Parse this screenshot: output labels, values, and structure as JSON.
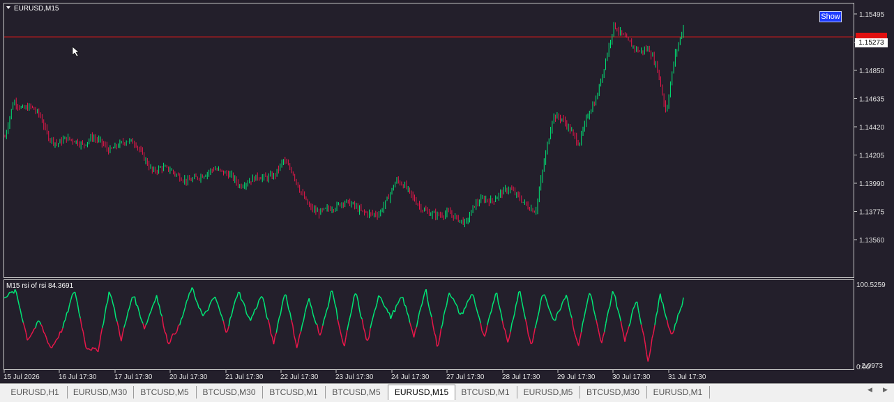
{
  "symbol_title": "EURUSD,M15",
  "show_button": "Show",
  "current_price": "1.15273",
  "indicator_label": "M15 rsi of rsi  84.3691",
  "colors": {
    "background": "#231f2b",
    "bull": "#00e676",
    "bear": "#e8174a",
    "price_line": "#d01818",
    "active_tab": "#ffffff"
  },
  "price_axis": [
    "1.15495",
    "1.15065",
    "1.14850",
    "1.14635",
    "1.14420",
    "1.14205",
    "1.13990",
    "1.13775",
    "1.13560"
  ],
  "indicator_axis": {
    "max": "100.5259",
    "min": "-2.0973",
    "overlap": "0.00"
  },
  "time_axis": [
    "15 Jul 2026",
    "16 Jul 17:30",
    "17 Jul 17:30",
    "20 Jul 17:30",
    "21 Jul 17:30",
    "22 Jul 17:30",
    "23 Jul 17:30",
    "24 Jul 17:30",
    "27 Jul 17:30",
    "28 Jul 17:30",
    "29 Jul 17:30",
    "30 Jul 17:30",
    "31 Jul 17:30"
  ],
  "tabs": [
    {
      "label": "EURUSD,H1",
      "active": false
    },
    {
      "label": "EURUSD,M30",
      "active": false
    },
    {
      "label": "BTCUSD,M5",
      "active": false
    },
    {
      "label": "BTCUSD,M30",
      "active": false
    },
    {
      "label": "BTCUSD,M1",
      "active": false
    },
    {
      "label": "BTCUSD,M5",
      "active": false
    },
    {
      "label": "EURUSD,M15",
      "active": true
    },
    {
      "label": "BTCUSD,M1",
      "active": false
    },
    {
      "label": "EURUSD,M5",
      "active": false
    },
    {
      "label": "BTCUSD,M30",
      "active": false
    },
    {
      "label": "EURUSD,M1",
      "active": false
    }
  ],
  "scroll_left_icon": "triangle-left",
  "scroll_right_icon": "triangle-right",
  "chart_data": {
    "type": "line",
    "series": [
      {
        "values": [
          1.1444,
          1.1475,
          1.1468,
          1.147,
          1.1463,
          1.1444,
          1.1438,
          1.1443,
          1.1441,
          1.1437,
          1.1444,
          1.144,
          1.1432,
          1.1437,
          1.1441,
          1.1439,
          1.1426,
          1.1414,
          1.1418,
          1.1416,
          1.141,
          1.1406,
          1.1409,
          1.1412,
          1.1417,
          1.1414,
          1.1411,
          1.1402,
          1.1406,
          1.141,
          1.1409,
          1.1411,
          1.1424,
          1.1415,
          1.1397,
          1.1384,
          1.1379,
          1.1382,
          1.1384,
          1.1389,
          1.1386,
          1.138,
          1.1378,
          1.1378,
          1.1391,
          1.1407,
          1.1402,
          1.1391,
          1.1382,
          1.1378,
          1.1377,
          1.1379,
          1.1374,
          1.137,
          1.1386,
          1.1391,
          1.1389,
          1.1396,
          1.14,
          1.1393,
          1.1385,
          1.138,
          1.1423,
          1.1462,
          1.146,
          1.145,
          1.1438,
          1.1463,
          1.1477,
          1.1508,
          1.154,
          1.1531,
          1.1523,
          1.1517,
          1.152,
          1.1503,
          1.1465,
          1.1513,
          1.1538
        ]
      },
      {
        "values": [
          88,
          95,
          30,
          55,
          18,
          45,
          98,
          20,
          15,
          97,
          30,
          92,
          45,
          90,
          25,
          50,
          100,
          60,
          88,
          40,
          96,
          55,
          90,
          25,
          95,
          20,
          85,
          35,
          98,
          18,
          95,
          25,
          92,
          60,
          88,
          35,
          98,
          20,
          95,
          62,
          93,
          30,
          96,
          25,
          98,
          20,
          93,
          55,
          92,
          20,
          96,
          22,
          98,
          30,
          85,
          2,
          90,
          35,
          84
        ]
      }
    ]
  }
}
